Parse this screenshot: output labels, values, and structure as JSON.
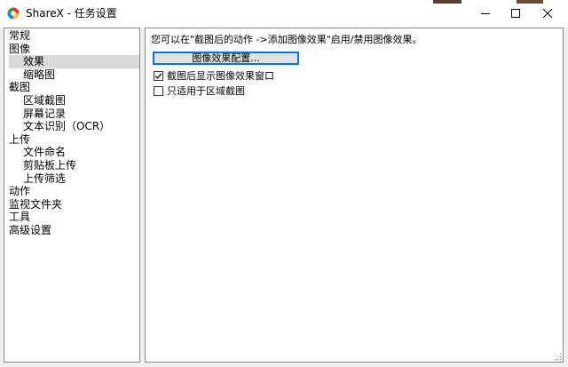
{
  "window": {
    "title": "ShareX - 任务设置"
  },
  "sidebar": {
    "items": [
      {
        "label": "常规",
        "level": 0,
        "selected": false
      },
      {
        "label": "图像",
        "level": 0,
        "selected": false
      },
      {
        "label": "效果",
        "level": 1,
        "selected": true
      },
      {
        "label": "缩略图",
        "level": 1,
        "selected": false
      },
      {
        "label": "截图",
        "level": 0,
        "selected": false
      },
      {
        "label": "区域截图",
        "level": 1,
        "selected": false
      },
      {
        "label": "屏幕记录",
        "level": 1,
        "selected": false
      },
      {
        "label": "文本识别（OCR）",
        "level": 1,
        "selected": false
      },
      {
        "label": "上传",
        "level": 0,
        "selected": false
      },
      {
        "label": "文件命名",
        "level": 1,
        "selected": false
      },
      {
        "label": "剪贴板上传",
        "level": 1,
        "selected": false
      },
      {
        "label": "上传筛选",
        "level": 1,
        "selected": false
      },
      {
        "label": "动作",
        "level": 0,
        "selected": false
      },
      {
        "label": "监视文件夹",
        "level": 0,
        "selected": false
      },
      {
        "label": "工具",
        "level": 0,
        "selected": false
      },
      {
        "label": "高级设置",
        "level": 0,
        "selected": false
      }
    ]
  },
  "effects": {
    "description": "您可以在\"截图后的动作 ->添加图像效果\"启用/禁用图像效果。",
    "config_button_label": "图像效果配置...",
    "show_window_checkbox": {
      "label": "截图后显示图像效果窗口",
      "checked": true
    },
    "region_only_checkbox": {
      "label": "只适用于区域截图",
      "checked": false
    }
  }
}
